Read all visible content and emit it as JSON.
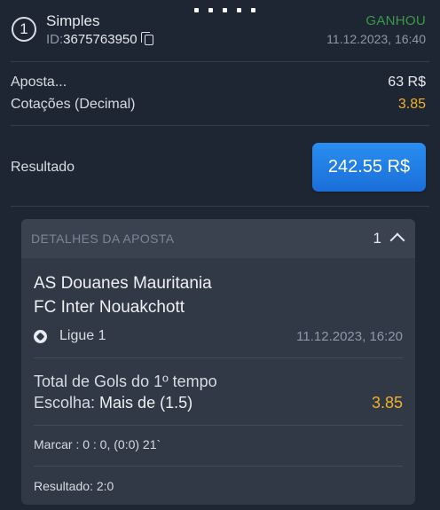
{
  "header": {
    "index": "1",
    "bet_type": "Simples",
    "id_label": "ID:",
    "id_value": "3675763950",
    "status": "GANHOU",
    "date": "11.12.2023, 16:40"
  },
  "summary": {
    "stake_label": "Aposta...",
    "stake_value": "63 R$",
    "odds_label": "Cotações (Decimal)",
    "odds_value": "3.85",
    "result_label": "Resultado",
    "result_value": "242.55 R$"
  },
  "details": {
    "title": "DETALHES DA APOSTA",
    "count": "1",
    "home_team": "AS Douanes Mauritania",
    "away_team": "FC Inter Nouakchott",
    "league": "Ligue 1",
    "match_date": "11.12.2023, 16:20",
    "market": "Total de Gols do 1º tempo",
    "pick_label": "Escolha:",
    "pick_value": "Mais de (1.5)",
    "pick_odds": "3.85",
    "score_line": "Marcar : 0 : 0, (0:0) 21`",
    "final_result": "Resultado: 2:0"
  },
  "colors": {
    "background": "#1f2633",
    "win_status": "#3a9a47",
    "odds": "#f0b12a",
    "result_button": "#1a6fd8"
  },
  "icons": [
    "index-badge-icon",
    "copy-icon",
    "chevron-up-icon",
    "soccer-ball-icon"
  ]
}
